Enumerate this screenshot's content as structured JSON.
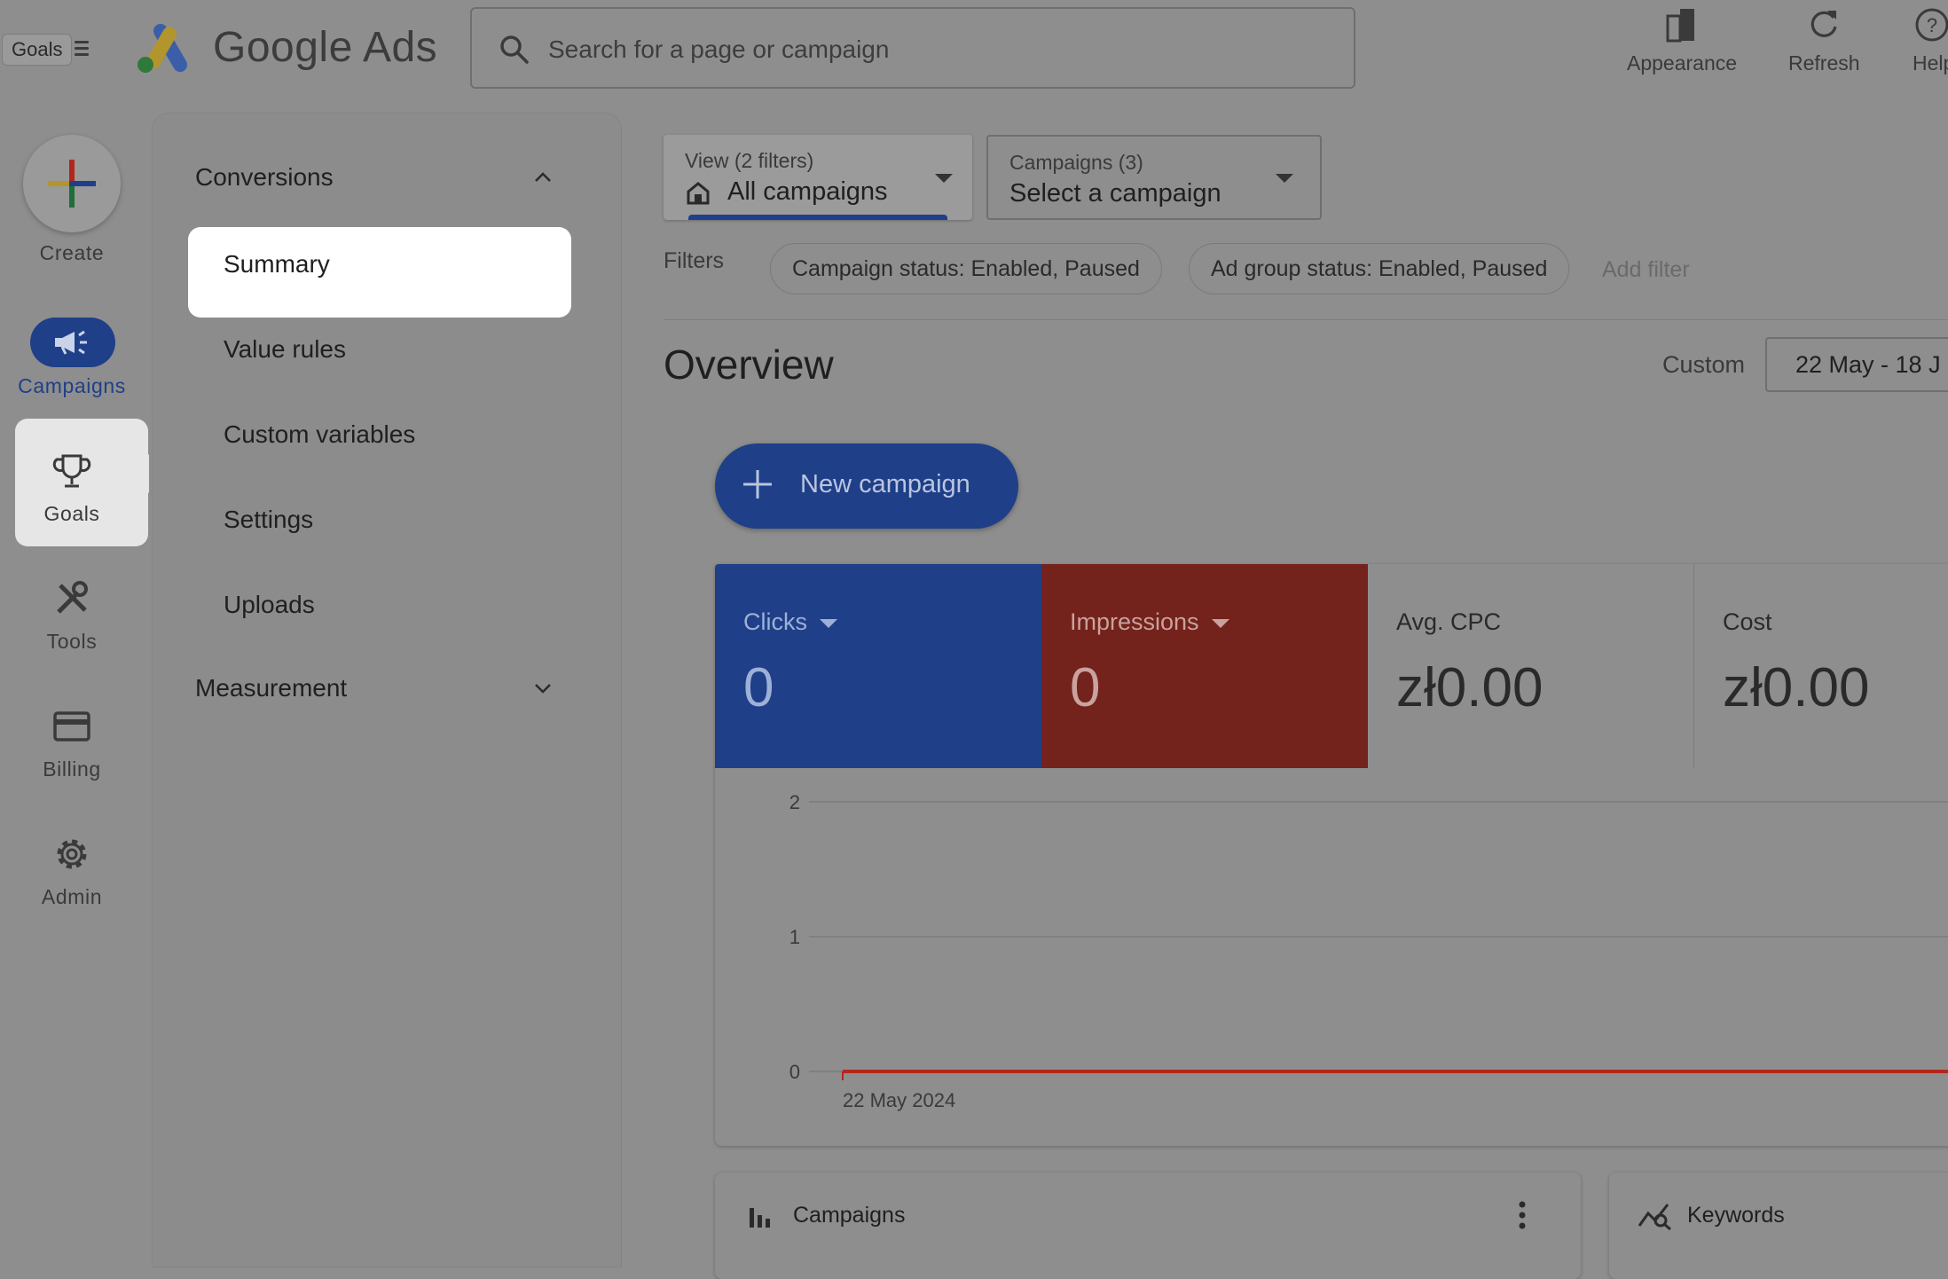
{
  "tooltip": "Goals",
  "brand": {
    "name": "Google Ads"
  },
  "search": {
    "placeholder": "Search for a page or campaign",
    "value": ""
  },
  "toolbar": {
    "appearance": "Appearance",
    "refresh": "Refresh",
    "help": "Help"
  },
  "rail": {
    "create": "Create",
    "campaigns": "Campaigns",
    "goals": "Goals",
    "tools": "Tools",
    "billing": "Billing",
    "admin": "Admin"
  },
  "subnav": {
    "conversions": "Conversions",
    "items": [
      "Summary",
      "Value rules",
      "Custom variables",
      "Settings",
      "Uploads"
    ],
    "measurement": "Measurement"
  },
  "view_filter": {
    "label": "View (2 filters)",
    "value": "All campaigns"
  },
  "campaign_select": {
    "label": "Campaigns (3)",
    "value": "Select a campaign"
  },
  "filters": {
    "label": "Filters",
    "chips": [
      "Campaign status: Enabled, Paused",
      "Ad group status: Enabled, Paused"
    ],
    "add": "Add filter"
  },
  "overview": {
    "title": "Overview",
    "range_label": "Custom",
    "date_range": "22 May - 18 J"
  },
  "new_campaign": "New campaign",
  "metrics": [
    {
      "label": "Clicks",
      "value": "0",
      "bg": "#1f3f88",
      "fg": "#9db0d6",
      "dropdown": true
    },
    {
      "label": "Impressions",
      "value": "0",
      "bg": "#73221c",
      "fg": "#c9a29e",
      "dropdown": true
    },
    {
      "label": "Avg. CPC",
      "value": "zł0.00",
      "bg": "#8e8e8e",
      "fg": "#2a2a2a",
      "dropdown": false
    },
    {
      "label": "Cost",
      "value": "zł0.00",
      "bg": "#8e8e8e",
      "fg": "#2a2a2a",
      "dropdown": false
    }
  ],
  "chart_data": {
    "type": "line",
    "y_ticks": [
      "2",
      "1",
      "0"
    ],
    "ylim": [
      0,
      2
    ],
    "x_start_label": "22 May 2024",
    "series": [
      {
        "values": [
          0,
          0
        ]
      }
    ],
    "colors": {
      "line": "#b3261e",
      "grid": "#7c7c7c"
    }
  },
  "bottom_cards": {
    "campaigns": "Campaigns",
    "keywords": "Keywords"
  }
}
